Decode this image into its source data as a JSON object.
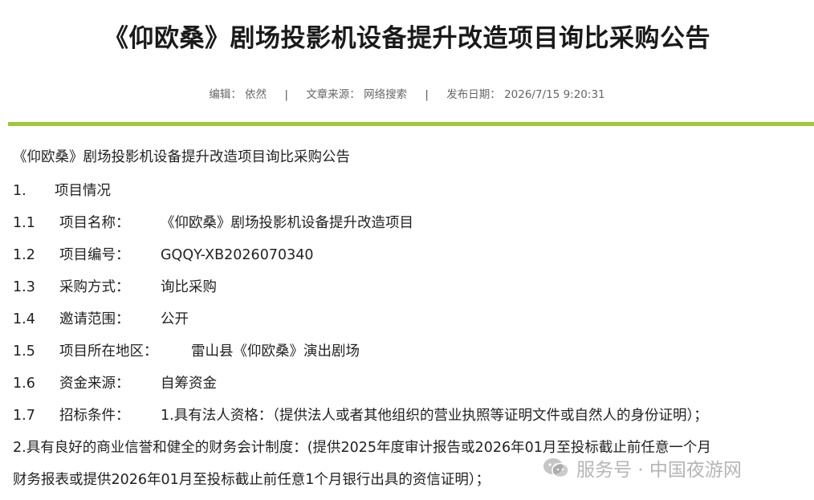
{
  "article": {
    "title": "《仰欧桑》剧场投影机设备提升改造项目询比采购公告",
    "meta": {
      "editor_label": "编辑：",
      "editor": "依然",
      "separator": "|",
      "source_label": "文章来源：",
      "source": "网络搜索",
      "date_label": "发布日期：",
      "date": "2026/7/15 9:20:31"
    },
    "accent_color": "#9fc837",
    "body": {
      "heading": "《仰欧桑》剧场投影机设备提升改造项目询比采购公告",
      "section1": {
        "num": "1.",
        "label": "项目情况"
      },
      "items": [
        {
          "num": "1.1",
          "label": "项目名称：",
          "value": "《仰欧桑》剧场投影机设备提升改造项目"
        },
        {
          "num": "1.2",
          "label": "项目编号：",
          "value": "GQQY-XB2026070340"
        },
        {
          "num": "1.3",
          "label": "采购方式：",
          "value": "询比采购"
        },
        {
          "num": "1.4",
          "label": "邀请范围：",
          "value": "公开"
        },
        {
          "num": "1.5",
          "label": "项目所在地区：",
          "value": "雷山县《仰欧桑》演出剧场"
        },
        {
          "num": "1.6",
          "label": "资金来源：",
          "value": "自筹资金"
        },
        {
          "num": "1.7",
          "label": "招标条件：",
          "value": "1.具有法人资格：（提供法人或者其他组织的营业执照等证明文件或自然人的身份证明）；"
        }
      ],
      "para2_line1": "2.具有良好的商业信誉和健全的财务会计制度：(提供2025年度审计报告或2026年01月至投标截止前任意一个月",
      "para2_line2": "财务报表或提供2026年01月至投标截止前任意1个月银行出具的资信证明）；"
    },
    "watermark": {
      "icon": "wechat-icon",
      "text": "服务号 · 中国夜游网"
    }
  }
}
